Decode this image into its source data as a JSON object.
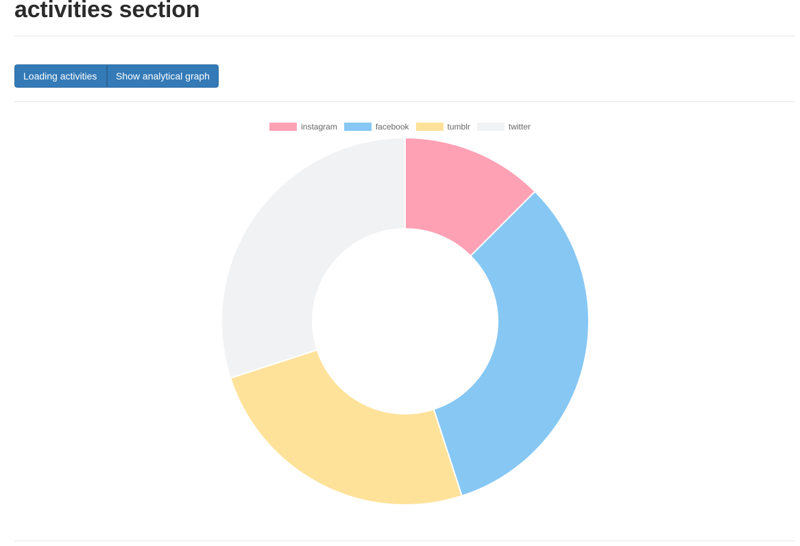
{
  "page": {
    "title": "activities section"
  },
  "buttons": {
    "loading_label": "Loading activities",
    "graph_label": "Show analytical graph"
  },
  "chart_data": {
    "type": "pie",
    "variant": "doughnut",
    "legend_position": "top",
    "categories": [
      "instagram",
      "facebook",
      "tumblr",
      "twitter"
    ],
    "values": [
      12.5,
      32.5,
      25.0,
      30.0
    ],
    "colors": [
      "#ffa1b5",
      "#86c7f3",
      "#ffe29a",
      "#f1f2f4"
    ],
    "title": ""
  }
}
